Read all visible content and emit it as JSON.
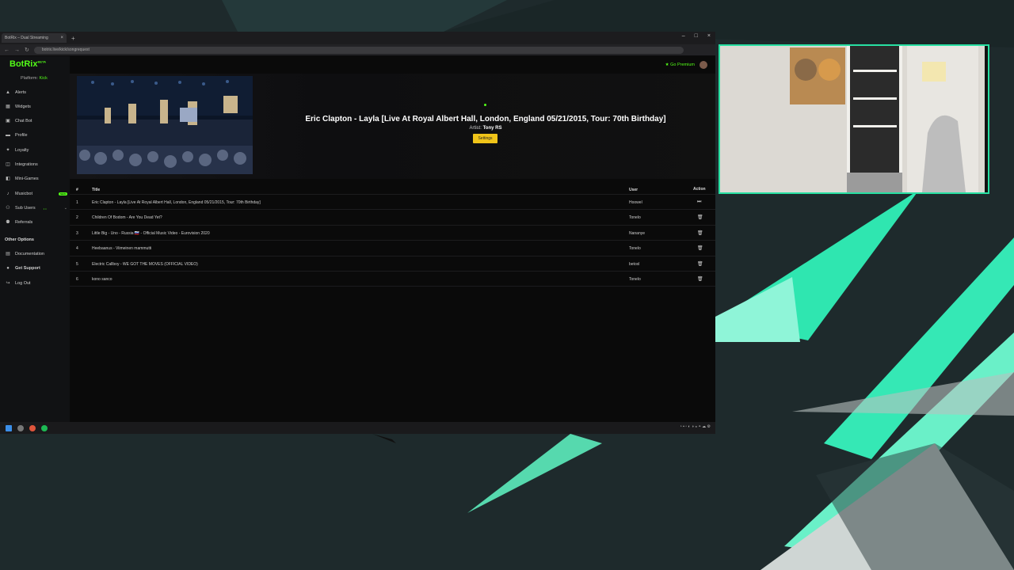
{
  "browser": {
    "tab_title": "BotRix – Dual Streaming",
    "url": "botrix.live/kick/songrequest"
  },
  "app": {
    "logo": "BotRix",
    "logo_sup": "BETA",
    "platform_label": "Platform:",
    "platform_value": "Kick",
    "premium_label": "Go Premium",
    "nav": [
      {
        "label": "Alerts",
        "icon": "alert-icon"
      },
      {
        "label": "Widgets",
        "icon": "widget-icon"
      },
      {
        "label": "Chat Bot",
        "icon": "chatbot-icon"
      },
      {
        "label": "Profile",
        "icon": "profile-icon"
      },
      {
        "label": "Loyalty",
        "icon": "loyalty-icon"
      },
      {
        "label": "Integrations",
        "icon": "integrations-icon"
      },
      {
        "label": "Mini-Games",
        "icon": "games-icon"
      },
      {
        "label": "Musicbot",
        "icon": "music-icon",
        "badge": "NEW"
      },
      {
        "label": "Sub Users",
        "icon": "users-icon"
      },
      {
        "label": "Referrals",
        "icon": "referrals-icon"
      }
    ],
    "other_options_title": "Other Options",
    "other_nav": [
      {
        "label": "Documentation",
        "icon": "docs-icon"
      },
      {
        "label": "Get Support",
        "icon": "support-icon"
      },
      {
        "label": "Log Out",
        "icon": "logout-icon"
      }
    ]
  },
  "now_playing": {
    "title": "Eric Clapton - Layla [Live At Royal Albert Hall, London, England 05/21/2015, Tour: 70th Birthday]",
    "artist_label": "Artist:",
    "artist": "Tony RS",
    "settings_label": "Settings"
  },
  "queue": {
    "headers": {
      "num": "#",
      "title": "Title",
      "user": "User",
      "action": "Action"
    },
    "rows": [
      {
        "num": "1",
        "title": "Eric Clapton - Layla [Live At Royal Albert Hall, London, England 05/21/2015, Tour: 70th Birthday]",
        "user": "Hoowel",
        "action": "skip-icon"
      },
      {
        "num": "2",
        "title": "Children Of Bodom - Are You Dead Yet?",
        "user": "Tonelo",
        "action": "delete-icon"
      },
      {
        "num": "3",
        "title": "Little Big - Uno - Russia 🇷🇺 - Official Music Video - Eurovision 2020",
        "user": "Nananye",
        "action": "delete-icon"
      },
      {
        "num": "4",
        "title": "Heebaanus - Viimeinen mammutti",
        "user": "Tonelo",
        "action": "delete-icon"
      },
      {
        "num": "5",
        "title": "Electric Callboy - WE GOT THE MOVES (OFFICIAL VIDEO)",
        "user": "betoxl",
        "action": "delete-icon"
      },
      {
        "num": "6",
        "title": "kono sanco",
        "user": "Tonelo",
        "action": "delete-icon"
      }
    ]
  },
  "colors": {
    "brand": "#53fc18",
    "accent_teal": "#27e0a2",
    "settings_button": "#f0c419"
  }
}
